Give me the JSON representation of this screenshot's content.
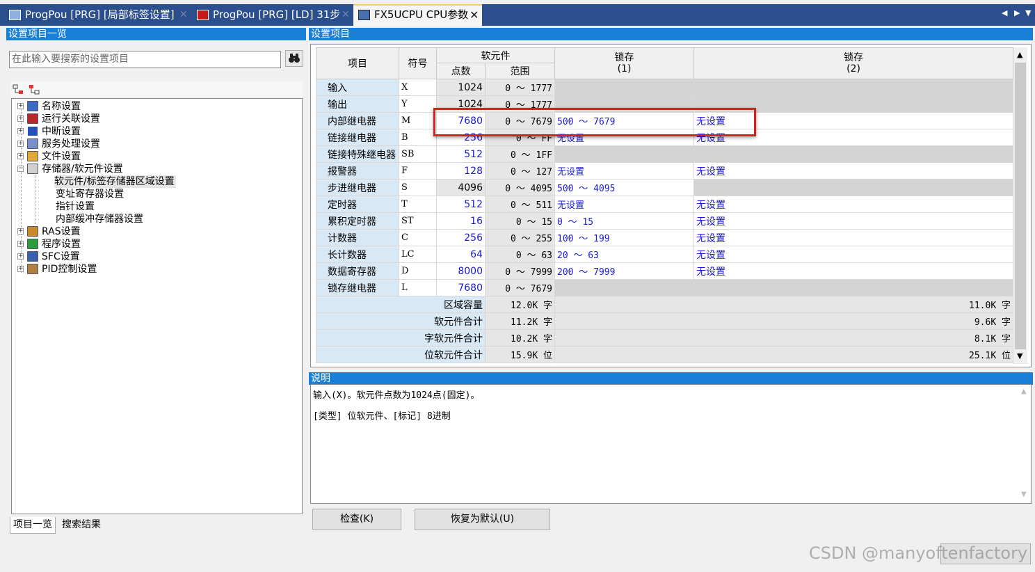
{
  "tabs": [
    {
      "label": "ProgPou [PRG] [局部标签设置]",
      "active": false
    },
    {
      "label": "ProgPou [PRG] [LD] 31步",
      "active": false
    },
    {
      "label": "FX5UCPU CPU参数",
      "active": true
    }
  ],
  "left_panel": {
    "title": "设置项目一览",
    "search_placeholder": "在此输入要搜索的设置项目",
    "tree": [
      {
        "label": "名称设置",
        "expander": "+",
        "icon": "name-settings"
      },
      {
        "label": "运行关联设置",
        "expander": "+",
        "icon": "run-settings"
      },
      {
        "label": "中断设置",
        "expander": "+",
        "icon": "interrupt-settings"
      },
      {
        "label": "服务处理设置",
        "expander": "+",
        "icon": "service-settings"
      },
      {
        "label": "文件设置",
        "expander": "+",
        "icon": "file-settings"
      },
      {
        "label": "存储器/软元件设置",
        "expander": "−",
        "icon": "memory-settings",
        "children": [
          "软元件/标签存储器区域设置",
          "变址寄存器设置",
          "指针设置",
          "内部缓冲存储器设置"
        ]
      },
      {
        "label": "RAS设置",
        "expander": "+",
        "icon": "ras-settings"
      },
      {
        "label": "程序设置",
        "expander": "+",
        "icon": "program-settings"
      },
      {
        "label": "SFC设置",
        "expander": "+",
        "icon": "sfc-settings"
      },
      {
        "label": "PID控制设置",
        "expander": "+",
        "icon": "pid-settings"
      }
    ],
    "bottom_tabs": [
      "项目一览",
      "搜索结果"
    ]
  },
  "right_panel": {
    "title": "设置项目",
    "headers": {
      "item": "项目",
      "symbol": "符号",
      "device": "软元件",
      "points": "点数",
      "range": "范围",
      "latch1": "锁存\n(1)",
      "latch2": "锁存\n(2)"
    },
    "rows": [
      {
        "name": "输入",
        "sym": "X",
        "count": "1024",
        "range": "0 ～ 1777",
        "latch1": "",
        "latch2": "",
        "fixed": true,
        "l1grey": true,
        "l2grey": true
      },
      {
        "name": "输出",
        "sym": "Y",
        "count": "1024",
        "range": "0 ～ 1777",
        "latch1": "",
        "latch2": "",
        "fixed": true,
        "l1grey": true,
        "l2grey": true
      },
      {
        "name": "内部继电器",
        "sym": "M",
        "count": "7680",
        "range": "0 ～ 7679",
        "latch1": "500 ～ 7679",
        "latch2": "无设置"
      },
      {
        "name": "链接继电器",
        "sym": "B",
        "count": "256",
        "range": "0 ～ FF",
        "latch1": "无设置",
        "latch2": "无设置"
      },
      {
        "name": "链接特殊继电器",
        "sym": "SB",
        "count": "512",
        "range": "0 ～ 1FF",
        "latch1": "",
        "latch2": "",
        "l1grey": true,
        "l2grey": true
      },
      {
        "name": "报警器",
        "sym": "F",
        "count": "128",
        "range": "0 ～ 127",
        "latch1": "无设置",
        "latch2": "无设置"
      },
      {
        "name": "步进继电器",
        "sym": "S",
        "count": "4096",
        "range": "0 ～ 4095",
        "latch1": "500 ～ 4095",
        "latch2": "",
        "fixed": true,
        "l2grey": true
      },
      {
        "name": "定时器",
        "sym": "T",
        "count": "512",
        "range": "0 ～ 511",
        "latch1": "无设置",
        "latch2": "无设置"
      },
      {
        "name": "累积定时器",
        "sym": "ST",
        "count": "16",
        "range": "0 ～ 15",
        "latch1": "0 ～ 15",
        "latch2": "无设置"
      },
      {
        "name": "计数器",
        "sym": "C",
        "count": "256",
        "range": "0 ～ 255",
        "latch1": "100 ～ 199",
        "latch2": "无设置"
      },
      {
        "name": "长计数器",
        "sym": "LC",
        "count": "64",
        "range": "0 ～ 63",
        "latch1": "20 ～ 63",
        "latch2": "无设置"
      },
      {
        "name": "数据寄存器",
        "sym": "D",
        "count": "8000",
        "range": "0 ～ 7999",
        "latch1": "200 ～ 7999",
        "latch2": "无设置"
      },
      {
        "name": "锁存继电器",
        "sym": "L",
        "count": "7680",
        "range": "0 ～ 7679",
        "latch1": "",
        "latch2": "",
        "l1grey": true,
        "l2grey": true
      }
    ],
    "summary": [
      {
        "label": "区域容量",
        "left": "12.0K 字",
        "right": "11.0K 字"
      },
      {
        "label": "软元件合计",
        "left": "11.2K 字",
        "right": "9.6K 字"
      },
      {
        "label": "字软元件合计",
        "left": "10.2K 字",
        "right": "8.1K 字"
      },
      {
        "label": "位软元件合计",
        "left": "15.9K 位",
        "right": "25.1K 位"
      }
    ],
    "desc_title": "说明",
    "desc_lines": [
      "输入(X)。软元件点数为1024点(固定)。",
      "[类型] 位软元件、[标记] 8进制"
    ],
    "buttons": {
      "check": "检查(K)",
      "restore": "恢复为默认(U)"
    }
  },
  "watermark": "CSDN @manyoftenfactory",
  "colors": {
    "titlebar": "#2b4e8c",
    "panel_header": "#1a7fd6",
    "highlight": "#d42020",
    "value_blue": "#1a1ad0"
  }
}
